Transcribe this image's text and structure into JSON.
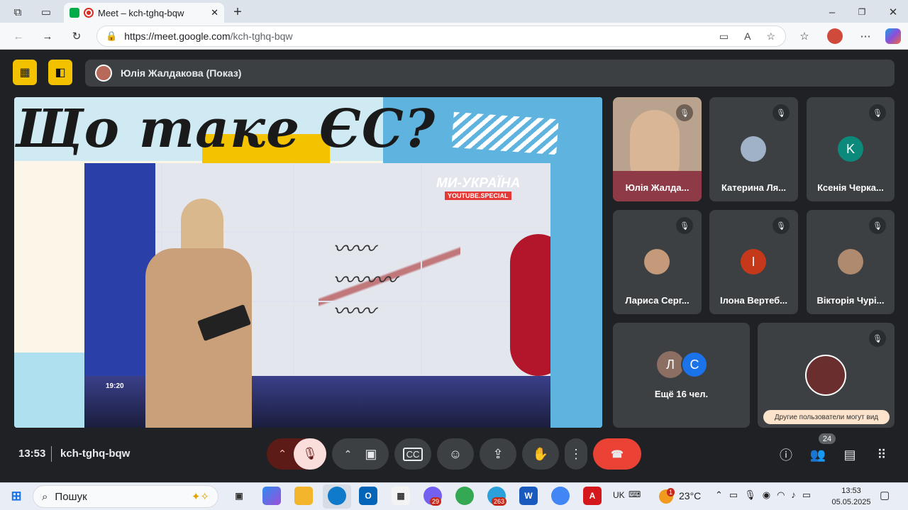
{
  "browser": {
    "tab_title": "Meet – kch-tghq-bqw",
    "url_host": "https://meet.google.com",
    "url_path": "/kch-tghq-bqw"
  },
  "meet": {
    "presenter": "Юлія Жалдакова (Показ)",
    "slide": {
      "title": "Що таке ЄС?",
      "brand": "МИ-УКРАЇНА",
      "brand_sub": "YOUTUBE.SPECIAL",
      "clock": "19:20"
    },
    "participants": [
      {
        "name": "Юлія Жалда...",
        "type": "video"
      },
      {
        "name": "Катерина Ля...",
        "type": "photo"
      },
      {
        "name": "Ксенія Черка...",
        "type": "initial",
        "initial": "K",
        "color": "#0b8a7c"
      },
      {
        "name": "Лариса Серг...",
        "type": "photo"
      },
      {
        "name": "Ілона Вертеб...",
        "type": "initial",
        "initial": "I",
        "color": "#c5391a"
      },
      {
        "name": "Вікторія Чурі...",
        "type": "photo"
      }
    ],
    "others": {
      "label": "Ещё 16 чел.",
      "a1": "Л",
      "a1_color": "#8d6e63",
      "a2": "С",
      "a2_color": "#1a73e8"
    },
    "self_tile_notice": "Другие пользователи могут вид",
    "time": "13:53",
    "meeting_code": "kch-tghq-bqw",
    "people_count": "24"
  },
  "taskbar": {
    "search_label": "Пошук",
    "lang": "UK",
    "temp": "23°C",
    "weather_badge": "1",
    "clock_time": "13:53",
    "clock_date": "05.05.2025",
    "viber_badge": "29",
    "telegram_badge": "263"
  }
}
